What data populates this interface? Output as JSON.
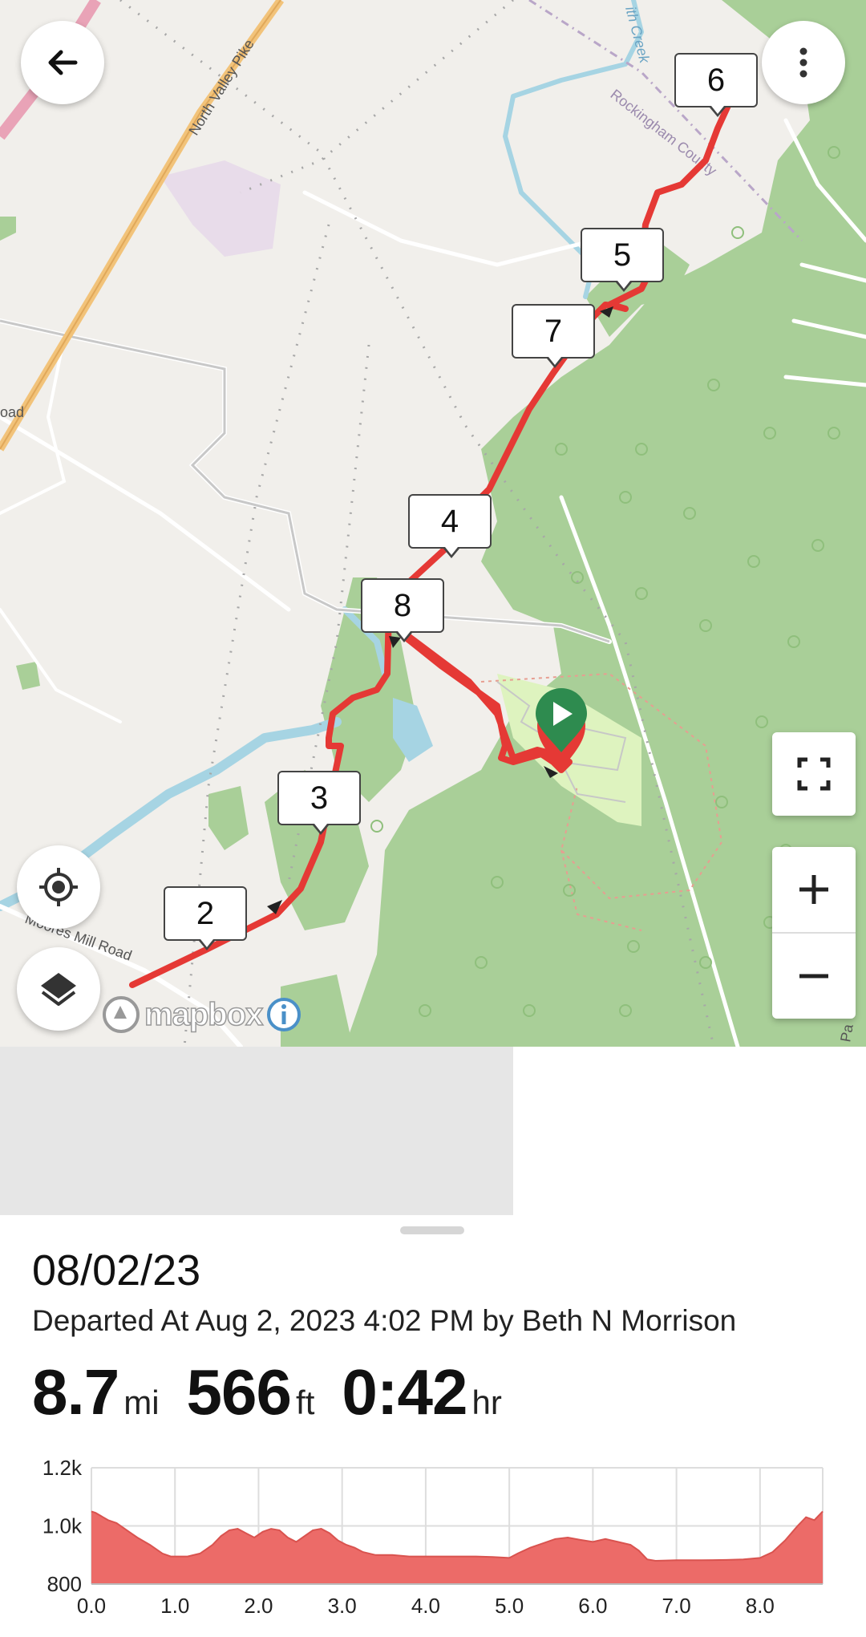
{
  "map": {
    "labels": {
      "road_north_valley": "North Valley Pike",
      "road_moores_mill": "Moores Mill Road",
      "county": "Rockingham County",
      "creek": "ith Creek",
      "road_left": "oad",
      "road_right": "Pa"
    },
    "mile_markers": [
      "2",
      "3",
      "4",
      "5",
      "6",
      "7",
      "8"
    ],
    "attribution": "mapbox",
    "colors": {
      "route": "#e53935",
      "forest": "#a9cf98",
      "water": "#a6d4e3",
      "start_pin": "#2e8b4f",
      "land": "#f1efeb"
    }
  },
  "controls": {
    "back": "back-arrow-icon",
    "more": "more-vertical-icon",
    "locate": "locate-icon",
    "layers": "layers-icon",
    "fullscreen": "fullscreen-icon",
    "zoom_in": "plus-icon",
    "zoom_out": "minus-icon"
  },
  "activity": {
    "title": "08/02/23",
    "subtitle": "Departed At Aug 2, 2023 4:02 PM by Beth N Morrison",
    "stats": [
      {
        "value": "8.7",
        "unit": "mi"
      },
      {
        "value": "566",
        "unit": "ft"
      },
      {
        "value": "0:42",
        "unit": "hr"
      }
    ]
  },
  "chart_data": {
    "type": "area",
    "xlabel": "",
    "ylabel": "",
    "xlim": [
      0,
      8.75
    ],
    "ylim": [
      800,
      1200
    ],
    "x_ticks": [
      "0.0",
      "1.0",
      "2.0",
      "3.0",
      "4.0",
      "5.0",
      "6.0",
      "7.0",
      "8.0"
    ],
    "y_ticks": [
      "800",
      "1.0k",
      "1.2k"
    ],
    "color": "#ec6b68",
    "x": [
      0.0,
      0.05,
      0.2,
      0.3,
      0.45,
      0.55,
      0.7,
      0.85,
      0.95,
      1.05,
      1.15,
      1.3,
      1.45,
      1.55,
      1.65,
      1.75,
      1.85,
      1.95,
      2.05,
      2.15,
      2.25,
      2.35,
      2.45,
      2.55,
      2.65,
      2.75,
      2.85,
      2.95,
      3.05,
      3.15,
      3.25,
      3.4,
      3.6,
      3.8,
      4.0,
      4.2,
      4.4,
      4.6,
      4.8,
      5.0,
      5.1,
      5.25,
      5.4,
      5.55,
      5.7,
      5.85,
      6.0,
      6.15,
      6.3,
      6.45,
      6.55,
      6.65,
      6.75,
      7.0,
      7.3,
      7.6,
      7.8,
      8.0,
      8.15,
      8.3,
      8.45,
      8.55,
      8.65,
      8.75
    ],
    "y": [
      1050,
      1045,
      1020,
      1010,
      980,
      960,
      935,
      905,
      895,
      895,
      895,
      905,
      935,
      965,
      985,
      990,
      975,
      960,
      980,
      990,
      985,
      960,
      945,
      965,
      985,
      990,
      975,
      950,
      935,
      925,
      910,
      900,
      900,
      895,
      895,
      895,
      895,
      895,
      893,
      890,
      905,
      925,
      940,
      955,
      960,
      952,
      945,
      955,
      945,
      935,
      915,
      885,
      880,
      882,
      882,
      883,
      885,
      890,
      910,
      950,
      1000,
      1030,
      1020,
      1050
    ]
  }
}
